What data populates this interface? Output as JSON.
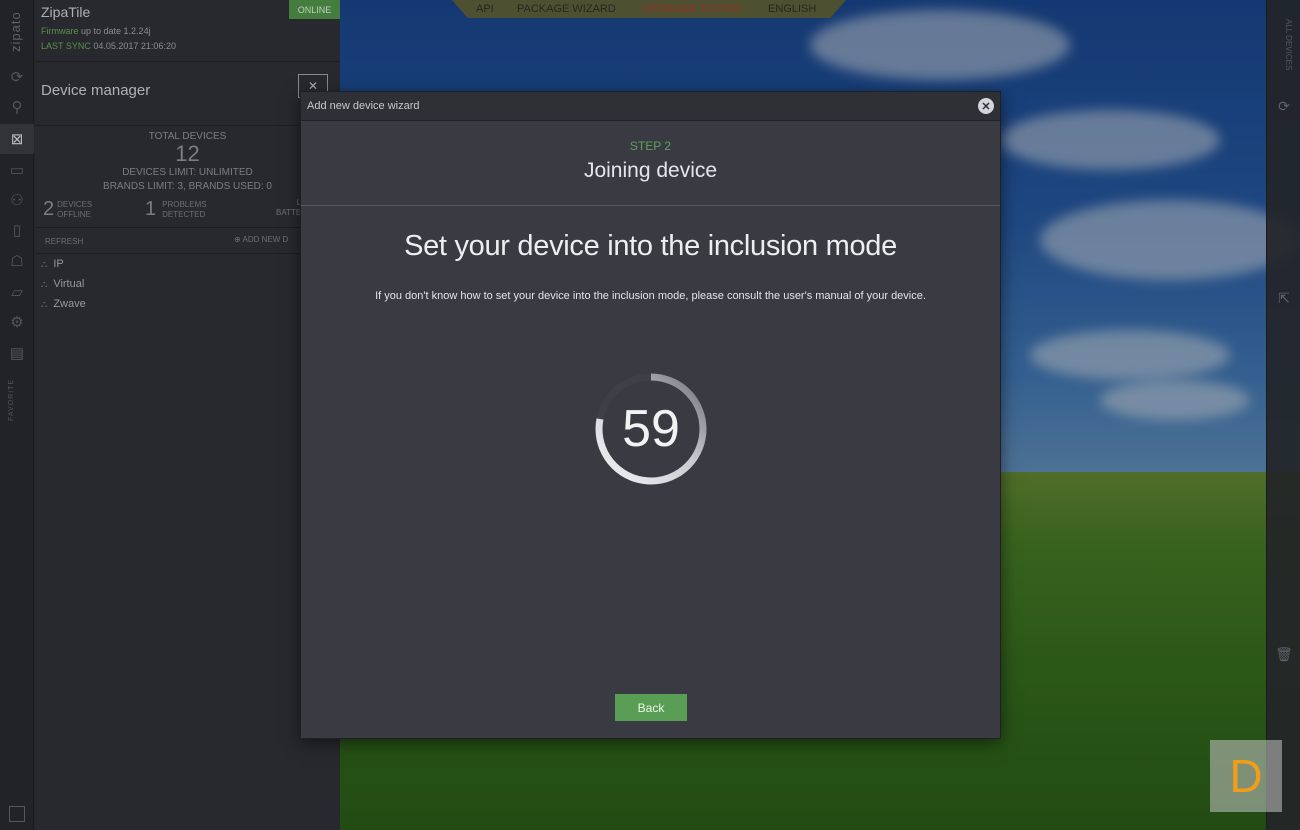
{
  "app": {
    "brand": "zipato",
    "name": "ZipaTile",
    "firmware_label": "Firmware",
    "firmware_status": "up to date 1.2.24j",
    "last_sync_label": "LAST SYNC",
    "last_sync_value": "04.05.2017 21:06:20",
    "status": "ONLINE"
  },
  "toolbar": {
    "api": "API",
    "package_wizard": "PACKAGE WIZARD",
    "upgrade": "UPGRADE TO PRO",
    "language": "ENGLISH"
  },
  "sidebar": {
    "title": "Device manager",
    "total_label": "TOTAL DEVICES",
    "total_count": "12",
    "devices_limit": "DEVICES LIMIT: UNLIMITED",
    "brands_limit": "BRANDS LIMIT: 3, BRANDS USED: 0",
    "offline_count": "2",
    "offline_label_1": "DEVICES",
    "offline_label_2": "OFFLINE",
    "problems_count": "1",
    "problems_label_1": "PROBLEMS",
    "problems_label_2": "DETECTED",
    "battery_label_1": "L",
    "battery_label_2": "BATTE",
    "refresh": "REFRESH",
    "add_new": "ADD NEW D",
    "items": [
      {
        "label": "IP"
      },
      {
        "label": "Virtual"
      },
      {
        "label": "Zwave"
      }
    ],
    "favorite_label": "FAVORITE"
  },
  "right_rail": {
    "tag": "ALL DEVICES"
  },
  "modal": {
    "title": "Add new device wizard",
    "step_label": "STEP 2",
    "step_title": "Joining device",
    "heading": "Set your device into the inclusion mode",
    "info": "If you don't know how to set your device into the inclusion mode, please consult the user's manual of your device.",
    "countdown": "59",
    "countdown_progress": 0.78,
    "back_label": "Back"
  },
  "badge": {
    "letter": "D",
    "color": "#f39c1a"
  },
  "colors": {
    "accent_green": "#5a9e55",
    "online_green": "#4e8f47",
    "upgrade_red": "#a83a2a"
  }
}
